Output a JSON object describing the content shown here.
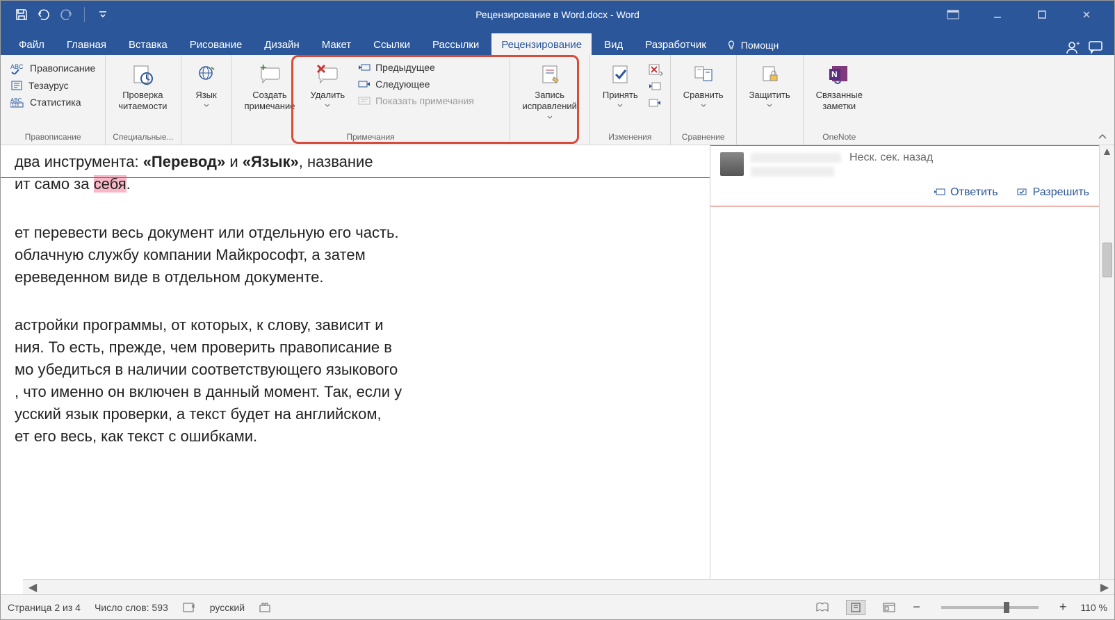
{
  "title": "Рецензирование в Word.docx - Word",
  "tabs": {
    "file": "Файл",
    "home": "Главная",
    "insert": "Вставка",
    "draw": "Рисование",
    "design": "Дизайн",
    "layout": "Макет",
    "references": "Ссылки",
    "mailings": "Рассылки",
    "review": "Рецензирование",
    "view": "Вид",
    "developer": "Разработчик",
    "help": "Помощн"
  },
  "ribbon": {
    "proofing": {
      "spelling": "Правописание",
      "thesaurus": "Тезаурус",
      "statistics": "Статистика",
      "group": "Правописание"
    },
    "accessibility": {
      "check": "Проверка\nчитаемости",
      "group": "Специальные..."
    },
    "language": {
      "label": "Язык"
    },
    "comments": {
      "new": "Создать\nпримечание",
      "delete": "Удалить",
      "previous": "Предыдущее",
      "next": "Следующее",
      "show": "Показать примечания",
      "group": "Примечания"
    },
    "tracking": {
      "track": "Запись\nисправлений"
    },
    "changes": {
      "accept": "Принять",
      "group": "Изменения"
    },
    "compare": {
      "label": "Сравнить",
      "group": "Сравнение"
    },
    "protect": {
      "label": "Защитить"
    },
    "onenote": {
      "label": "Связанные\nзаметки",
      "group": "OneNote"
    }
  },
  "document": {
    "line1a": "два инструмента: ",
    "line1b": "«Перевод»",
    "line1c": " и ",
    "line1d": "«Язык»",
    "line1e": ", название",
    "line2a": "ит само за ",
    "line2hl": "себя",
    "line2b": ".",
    "para2": "ет перевести весь документ или отдельную его часть.\nоблачную службу компании Майкрософт, а затем\nереведенном виде в отдельном документе.",
    "para3": "астройки программы, от которых, к слову, зависит и\nния. То есть, прежде, чем проверить правописание в\nмо убедиться в наличии соответствующего языкового\n, что именно он включен в данный момент. Так, если у\nусский язык проверки, а текст будет на английском,\nет его весь, как текст с ошибками."
  },
  "comment": {
    "time": "Неск. сек. назад",
    "reply": "Ответить",
    "resolve": "Разрешить"
  },
  "status": {
    "page": "Страница 2 из 4",
    "words": "Число слов: 593",
    "lang": "русский",
    "zoom": "110 %"
  }
}
